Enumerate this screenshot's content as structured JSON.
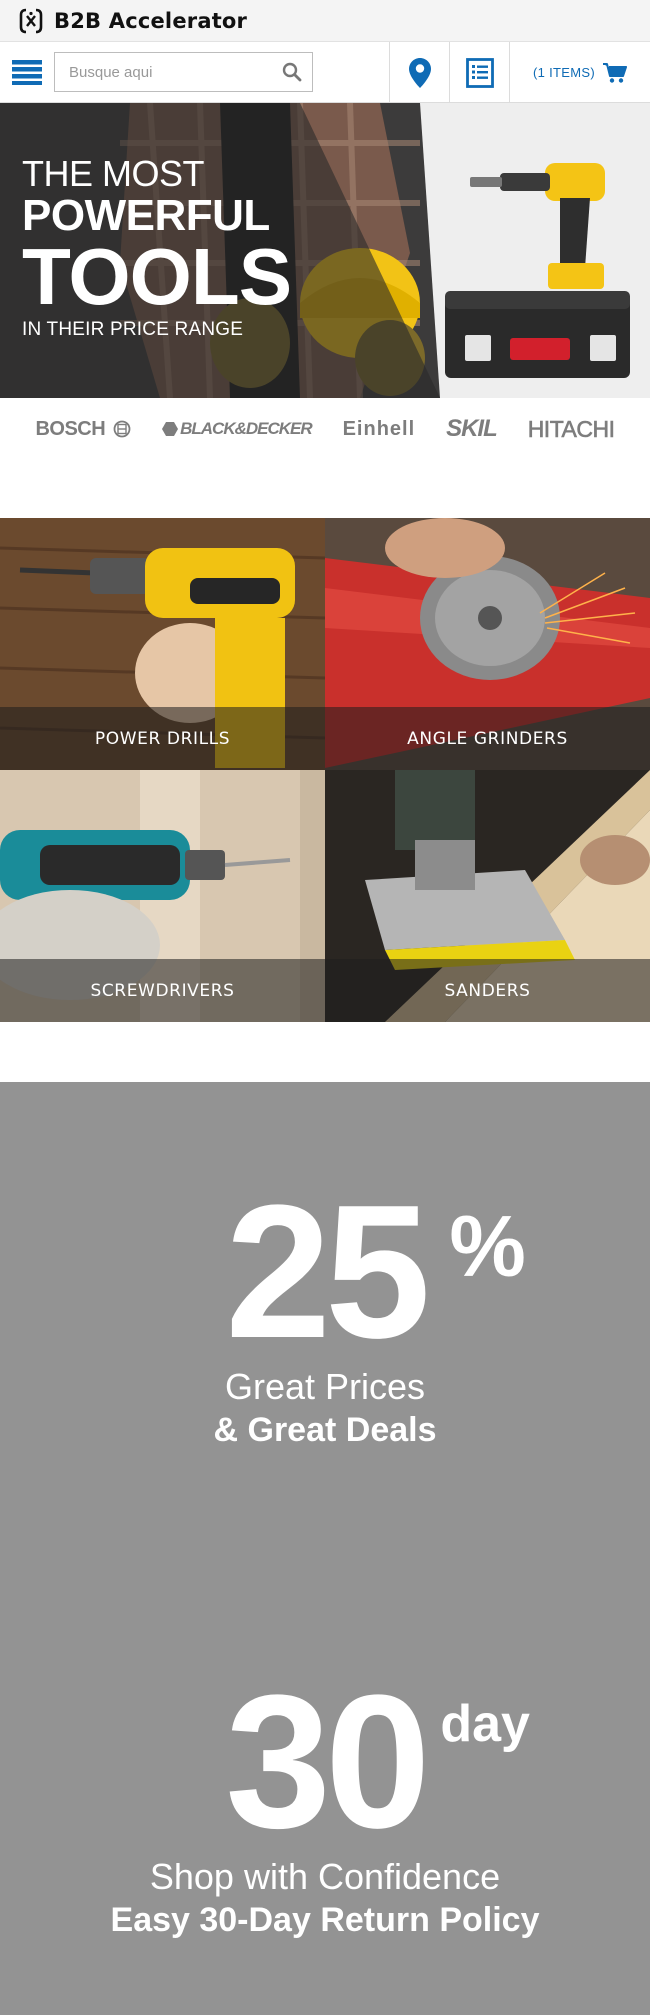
{
  "header": {
    "brand": "B2B Accelerator"
  },
  "nav": {
    "search_placeholder": "Busque aqui",
    "cart_label": "(1 ITEMS)"
  },
  "hero": {
    "line1": "THE MOST",
    "line2": "POWERFUL",
    "line3": "TOOLS",
    "line4": "IN THEIR PRICE RANGE"
  },
  "brands": [
    "BOSCH",
    "BLACK&DECKER",
    "Einhell",
    "SKIL",
    "HITACHI"
  ],
  "categories": [
    {
      "label": "POWER DRILLS"
    },
    {
      "label": "ANGLE GRINDERS"
    },
    {
      "label": "SCREWDRIVERS"
    },
    {
      "label": "SANDERS"
    }
  ],
  "promo": {
    "discount": "25",
    "discount_unit": "%",
    "discount_line1": "Great Prices",
    "discount_line2": "& Great Deals",
    "return_days": "30",
    "return_unit": "day",
    "return_line1": "Shop with Confidence",
    "return_line2": "Easy 30-Day Return Policy"
  },
  "colors": {
    "accent": "#0f6bb5",
    "promo_bg": "#939393",
    "logo_gray": "#7d7d7d"
  }
}
